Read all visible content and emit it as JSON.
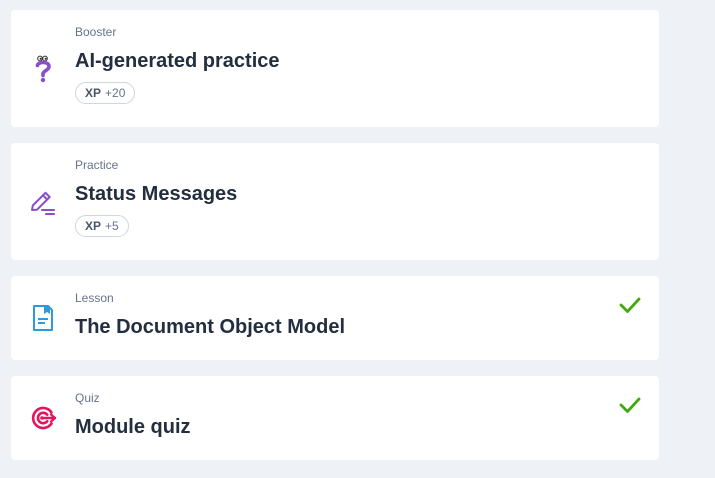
{
  "items": [
    {
      "kind": "Booster",
      "title": "AI-generated practice",
      "xp_label": "XP",
      "xp_value": "+20",
      "icon": "question-mark-icon",
      "icon_color": "#8a4ecb",
      "completed": false
    },
    {
      "kind": "Practice",
      "title": "Status Messages",
      "xp_label": "XP",
      "xp_value": "+5",
      "icon": "pencil-icon",
      "icon_color": "#8a4ecb",
      "completed": false
    },
    {
      "kind": "Lesson",
      "title": "The Document Object Model",
      "icon": "document-icon",
      "icon_color": "#2d9ae0",
      "completed": true
    },
    {
      "kind": "Quiz",
      "title": "Module quiz",
      "icon": "target-icon",
      "icon_color": "#e2155f",
      "completed": true
    }
  ],
  "colors": {
    "background": "#eef2f6",
    "card": "#ffffff",
    "title": "#232e3f",
    "secondary_text": "#65748b",
    "check": "#42a80f"
  }
}
